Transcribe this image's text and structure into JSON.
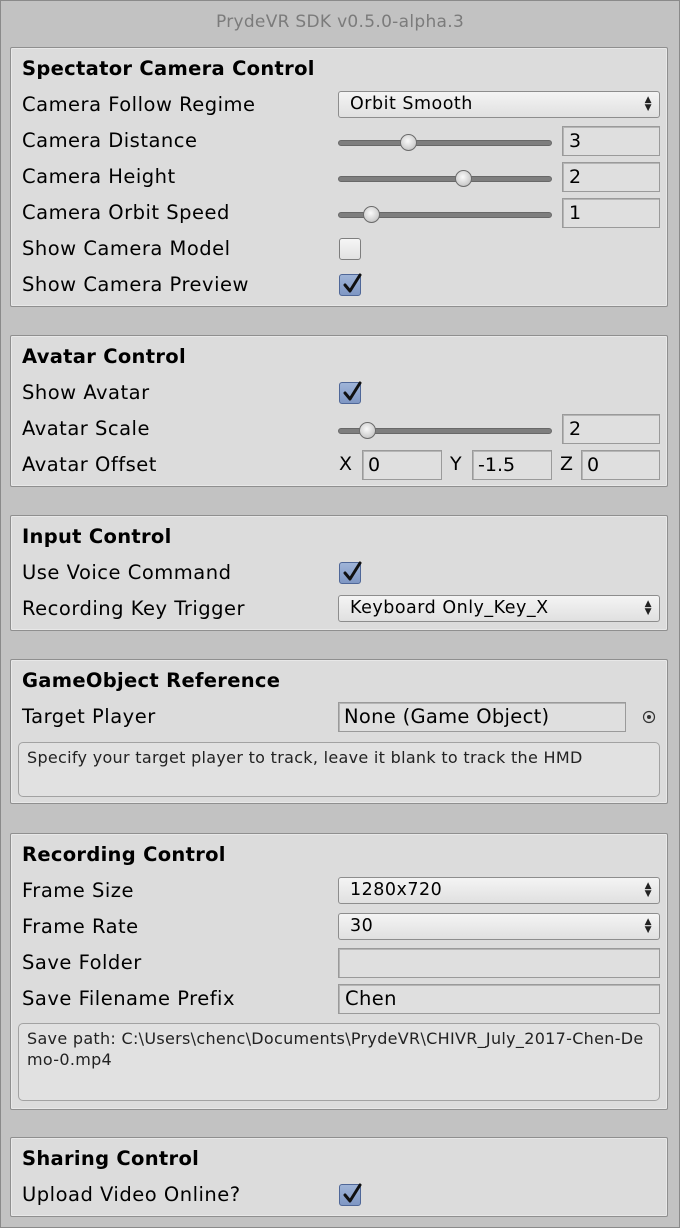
{
  "title": "PrydeVR SDK v0.5.0-alpha.3",
  "spectator": {
    "title": "Spectator Camera Control",
    "follow_label": "Camera Follow Regime",
    "follow_value": "Orbit Smooth",
    "distance_label": "Camera Distance",
    "distance_value": "3",
    "distance_fraction": 0.32,
    "height_label": "Camera Height",
    "height_value": "2",
    "height_fraction": 0.6,
    "orbit_label": "Camera Orbit Speed",
    "orbit_value": "1",
    "orbit_fraction": 0.13,
    "show_model_label": "Show Camera Model",
    "show_model_checked": false,
    "show_preview_label": "Show Camera Preview",
    "show_preview_checked": true
  },
  "avatar": {
    "title": "Avatar Control",
    "show_label": "Show Avatar",
    "show_checked": true,
    "scale_label": "Avatar Scale",
    "scale_value": "2",
    "scale_fraction": 0.11,
    "offset_label": "Avatar Offset",
    "x_label": "X",
    "x_value": "0",
    "y_label": "Y",
    "y_value": "-1.5",
    "z_label": "Z",
    "z_value": "0"
  },
  "input": {
    "title": "Input Control",
    "voice_label": "Use Voice Command",
    "voice_checked": true,
    "trigger_label": "Recording Key Trigger",
    "trigger_value": "Keyboard Only_Key_X"
  },
  "gameobject": {
    "title": "GameObject Reference",
    "target_label": "Target Player",
    "target_value": "None (Game Object)",
    "help": "Specify your target player to track, leave it blank to track the HMD"
  },
  "recording": {
    "title": "Recording Control",
    "frame_size_label": "Frame Size",
    "frame_size_value": "1280x720",
    "frame_rate_label": "Frame Rate",
    "frame_rate_value": "30",
    "save_folder_label": "Save Folder",
    "save_folder_value": "",
    "prefix_label": "Save Filename Prefix",
    "prefix_value": "Chen",
    "save_path": "Save path: C:\\Users\\chenc\\Documents\\PrydeVR\\CHIVR_July_2017-Chen-Demo-0.mp4"
  },
  "sharing": {
    "title": "Sharing Control",
    "upload_label": "Upload Video Online?",
    "upload_checked": true
  }
}
